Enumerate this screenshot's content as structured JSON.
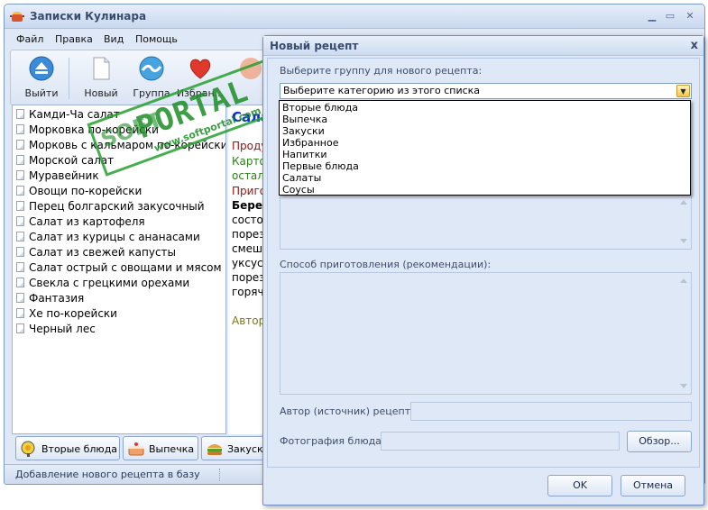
{
  "main_window": {
    "title": "Записки Кулинара",
    "menu": [
      "Файл",
      "Правка",
      "Вид",
      "Помощь"
    ],
    "toolbar": [
      "Выйти",
      "Новый",
      "Группа",
      "Избран..."
    ],
    "recipes": [
      "Камди-Ча салат",
      "Морковка по-корейски",
      "Морковь с кальмаром по-корейски",
      "Морской салат",
      "Муравейник",
      "Овощи по-корейски",
      "Перец болгарский закусочный",
      "Салат из картофеля",
      "Салат из курицы с ананасами",
      "Салат из свежей капусты",
      "Салат острый с овощами и мясом",
      "Свекла с грецкими орехами",
      "Фантазия",
      "Хе по-корейски",
      "Черный лес"
    ],
    "detail": {
      "title": "Сала",
      "l1": "Продук",
      "l2": "Картоф",
      "l3": "осталь",
      "l4": "Пригот",
      "l5": "Берет",
      "l6": "состоя",
      "l7": "порезa",
      "l8": "смеши",
      "l9": "уксуса",
      "l10": "порезa",
      "l11": "горяче",
      "l12": "Автор"
    },
    "tabs": [
      "Вторые блюда",
      "Выпечка",
      "Закуски"
    ],
    "status": "Добавление нового рецепта в базу"
  },
  "watermark": {
    "soft": "SOFT",
    "main": "PORTAL",
    "url": "www.softportal.com"
  },
  "dialog": {
    "title": "Новый рецепт",
    "close": "x",
    "group_label": "Выберите группу для нового рецепта:",
    "combo_value": "Выберите категорию из этого списка",
    "options": [
      "Вторые блюда",
      "Выпечка",
      "Закуски",
      "Избранное",
      "Напитки",
      "Первые блюда",
      "Салаты",
      "Соусы"
    ],
    "method_label": "Способ приготовления (рекомендации):",
    "author_label": "Автор (источник) рецепта:",
    "photo_label": "Фотография блюда:",
    "browse": "Обзор...",
    "ok": "OK",
    "cancel": "Отмена"
  },
  "colors": {
    "title_blue": "#0a2ad8",
    "red_text": "#a01010",
    "green_text": "#2e7d1b",
    "olive_text": "#7b7a1d",
    "watermark_green": "#1d8e26"
  }
}
